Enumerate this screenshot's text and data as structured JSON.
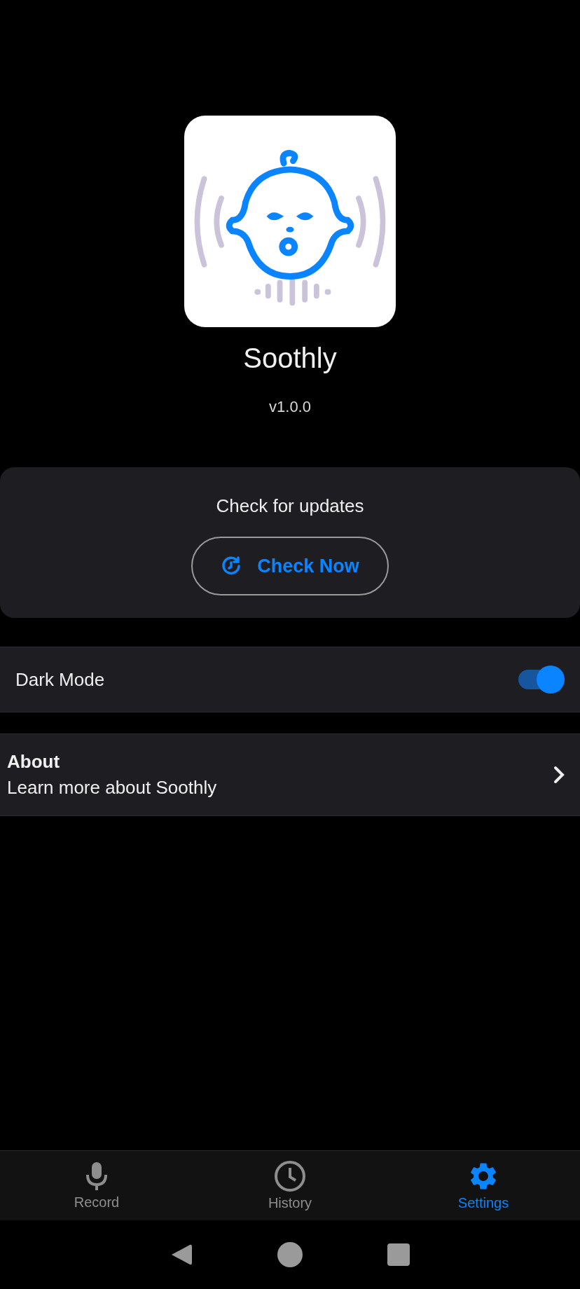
{
  "app": {
    "name": "Soothly",
    "version": "v1.0.0"
  },
  "updates": {
    "title": "Check for updates",
    "button": "Check Now"
  },
  "settings": [
    {
      "kind": "toggle",
      "label": "Dark Mode",
      "on": true
    },
    {
      "kind": "link",
      "title": "About",
      "subtitle": "Learn more about Soothly"
    }
  ],
  "tabs": [
    {
      "label": "Record",
      "kind": "mic",
      "selected": false
    },
    {
      "label": "History",
      "kind": "clock",
      "selected": false
    },
    {
      "label": "Settings",
      "kind": "gear",
      "selected": true
    }
  ]
}
